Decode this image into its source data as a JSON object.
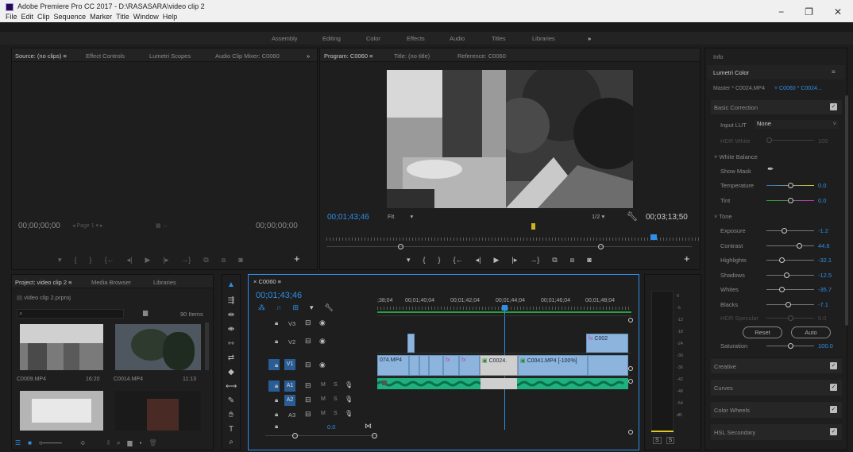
{
  "window": {
    "title": "Adobe Premiere Pro CC 2017 - D:\\RASASARA\\video clip 2",
    "menu": [
      "File",
      "Edit",
      "Clip",
      "Sequence",
      "Marker",
      "Title",
      "Window",
      "Help"
    ],
    "controls": [
      "−",
      "❐",
      "✕"
    ]
  },
  "workspaces": [
    "Assembly",
    "Editing",
    "Color",
    "Effects",
    "Audio",
    "Titles",
    "Libraries",
    "»"
  ],
  "source_panel": {
    "tabs": [
      "Source: (no clips)  ≡",
      "Effect Controls",
      "Lumetri Scopes",
      "Audio Clip Mixer: C0060",
      "»"
    ],
    "timecode_left": "00;00;00;00",
    "timecode_right": "00;00;00;00",
    "page": "Page 1"
  },
  "program_panel": {
    "tabs": [
      "Program: C0060  ≡",
      "Title: (no title)",
      "Reference: C0060"
    ],
    "timecode": "00;01;43;46",
    "fit": "Fit",
    "resolution": "1/2",
    "duration": "00;03;13;50"
  },
  "project_panel": {
    "tabs": [
      "Project: video clip 2  ≡",
      "Media Browser",
      "Libraries"
    ],
    "project_file": "video clip 2.prproj",
    "item_count": "90 Items",
    "clips": [
      {
        "name": "C0009.MP4",
        "duration": "16:20"
      },
      {
        "name": "C0014.MP4",
        "duration": "11:13"
      }
    ]
  },
  "timeline": {
    "tab": "C0060  ≡",
    "timecode": "00;01;43;46",
    "ruler": [
      ";38;04",
      "00;01;40;04",
      "00;01;42;04",
      "00;01;44;04",
      "00;01;46;04",
      "00;01;48;04"
    ],
    "tracks": [
      "V3",
      "V2",
      "V1",
      "A1",
      "A2",
      "A3"
    ],
    "track_labels": {
      "m": "M",
      "s": "S"
    },
    "master_value": "0.0",
    "clips": {
      "v1_a": "074.MP4",
      "v1_b": "C0024.",
      "v1_c": "C0041.MP4 [-100%]",
      "v2_a": "C002"
    }
  },
  "meter": {
    "scale": [
      "0",
      "-6",
      "-12",
      "-18",
      "-24",
      "-30",
      "-36",
      "-42",
      "-48",
      "-54",
      "dB"
    ],
    "solo": [
      "S",
      "S"
    ]
  },
  "lumetri": {
    "info_tab": "Info",
    "panel_title": "Lumetri Color",
    "master": "Master * C0024.MP4",
    "target": "C0060 * C0024...",
    "basic_correction": "Basic Correction",
    "input_lut_label": "Input LUT",
    "input_lut_value": "None",
    "hdr_white": "HDR White",
    "hdr_white_value": "100",
    "white_balance": "White Balance",
    "show_mask": "Show Mask",
    "temperature": {
      "label": "Temperature",
      "value": "0.0"
    },
    "tint": {
      "label": "Tint",
      "value": "0.0"
    },
    "tone": "Tone",
    "tone_rows": [
      {
        "label": "Exposure",
        "value": "-1.2",
        "pos": 0.35
      },
      {
        "label": "Contrast",
        "value": "44.6",
        "pos": 0.72
      },
      {
        "label": "Highlights",
        "value": "-32.1",
        "pos": 0.3
      },
      {
        "label": "Shadows",
        "value": "-12.5",
        "pos": 0.42
      },
      {
        "label": "Whites",
        "value": "-35.7",
        "pos": 0.3
      },
      {
        "label": "Blacks",
        "value": "-7.1",
        "pos": 0.45
      }
    ],
    "hdr_specular": "HDR Specular",
    "hdr_specular_value": "0.0",
    "reset": "Reset",
    "auto": "Auto",
    "saturation": {
      "label": "Saturation",
      "value": "100.0"
    },
    "sections": [
      "Creative",
      "Curves",
      "Color Wheels",
      "HSL Secondary"
    ],
    "colors": {
      "accent": "#2e8fe8",
      "audio": "#1eb07d",
      "video_clip": "#8cb4dd"
    }
  }
}
